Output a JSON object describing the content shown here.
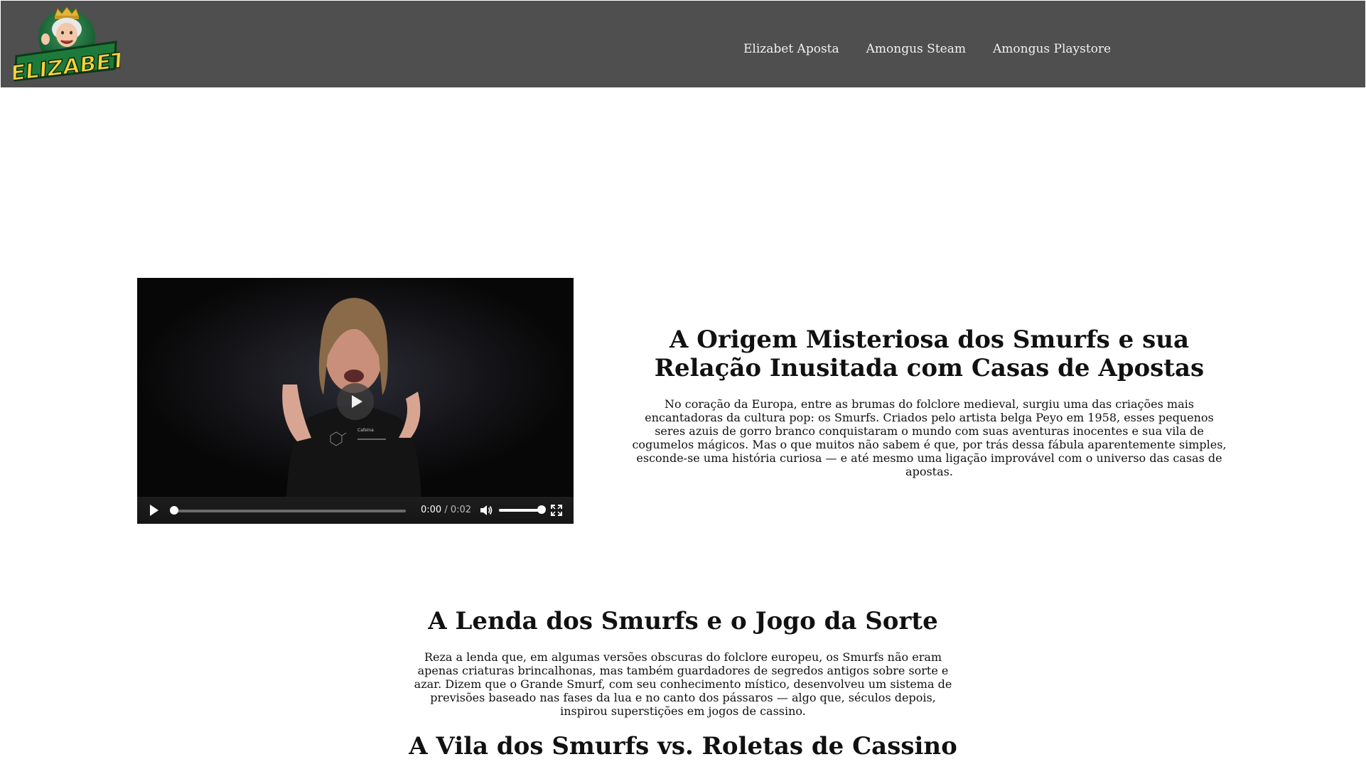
{
  "header": {
    "logo_text": "ELIZABET",
    "nav": [
      {
        "label": "Elizabet Aposta"
      },
      {
        "label": "Amongus Steam"
      },
      {
        "label": "Amongus Playstore"
      }
    ]
  },
  "video": {
    "current_time": "0:00",
    "separator": "/",
    "duration": "0:02",
    "progress": 0.0,
    "volume": 1.0
  },
  "hero": {
    "title": "A Origem Misteriosa dos Smurfs e sua Relação Inusitada com Casas de Apostas",
    "text": "No coração da Europa, entre as brumas do folclore medieval, surgiu uma das criações mais encantadoras da cultura pop: os Smurfs. Criados pelo artista belga Peyo em 1958, esses pequenos seres azuis de gorro branco conquistaram o mundo com suas aventuras inocentes e sua vila de cogumelos mágicos. Mas o que muitos não sabem é que, por trás dessa fábula aparentemente simples, esconde-se uma história curiosa — e até mesmo uma ligação improvável com o universo das casas de apostas."
  },
  "sections": [
    {
      "title": "A Lenda dos Smurfs e o Jogo da Sorte",
      "text": "Reza a lenda que, em algumas versões obscuras do folclore europeu, os Smurfs não eram apenas criaturas brincalhonas, mas também guardadores de segredos antigos sobre sorte e azar. Dizem que o Grande Smurf, com seu conhecimento místico, desenvolveu um sistema de previsões baseado nas fases da lua e no canto dos pássaros — algo que, séculos depois, inspirou superstições em jogos de cassino."
    },
    {
      "title": "A Vila dos Smurfs vs. Roletas de Cassino"
    }
  ]
}
